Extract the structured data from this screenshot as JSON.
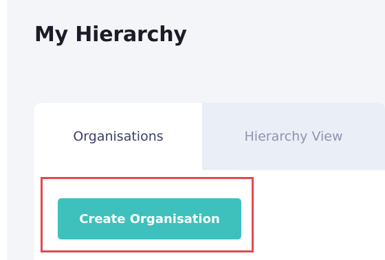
{
  "header": {
    "title": "My Hierarchy"
  },
  "tabs": [
    {
      "label": "Organisations",
      "active": true
    },
    {
      "label": "Hierarchy View",
      "active": false
    }
  ],
  "actions": {
    "create_label": "Create Organisation"
  },
  "colors": {
    "accent": "#3ec0bd",
    "highlight": "#e4474d",
    "active_tab_text": "#3a3f6b",
    "inactive_tab_text": "#8e94ad"
  }
}
